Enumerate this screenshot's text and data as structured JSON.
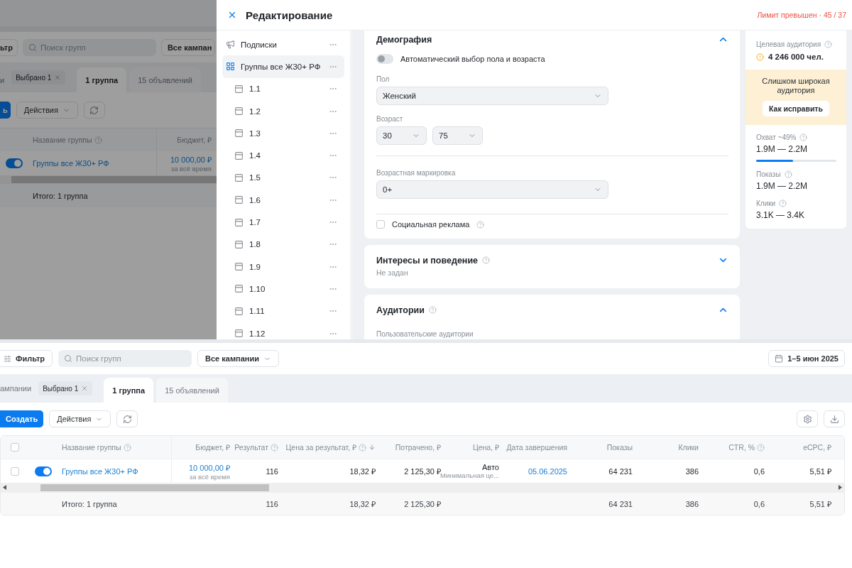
{
  "background_view": {
    "filter_button": "ьтр",
    "search": {
      "placeholder": "Поиск групп"
    },
    "campaign_select": "Все кампан",
    "tabs": [
      {
        "label": "и",
        "chip": "Выбрано 1",
        "selected": false
      },
      {
        "label": "1 группа",
        "selected": true
      },
      {
        "label": "15 объявлений",
        "selected": false
      }
    ],
    "create_button": "ь",
    "actions_button": "Действия",
    "columns": [
      {
        "label": "Название группы",
        "help": true
      },
      {
        "label": "Бюджет, ₽",
        "help": false
      }
    ],
    "rows": [
      {
        "enabled": true,
        "cells": [
          {
            "kind": "link",
            "text": "Группы все Ж30+ РФ"
          },
          {
            "kind": "link",
            "text": "10 000,00 ₽",
            "note": "за всё время"
          }
        ]
      }
    ],
    "total": "Итого: 1 группа"
  },
  "editor": {
    "title": "Редактирование",
    "limit": "Лимит превышен · 45 / 37",
    "tree": [
      {
        "kind": "campaign",
        "label": "Подписки",
        "selected": false
      },
      {
        "kind": "group",
        "label": "Группы все Ж30+ РФ",
        "selected": true,
        "children": [
          {
            "kind": "ad",
            "label": "1.1",
            "selected": false
          },
          {
            "kind": "ad",
            "label": "1.2",
            "selected": false
          },
          {
            "kind": "ad",
            "label": "1.3",
            "selected": false
          },
          {
            "kind": "ad",
            "label": "1.4",
            "selected": false
          },
          {
            "kind": "ad",
            "label": "1.5",
            "selected": false
          },
          {
            "kind": "ad",
            "label": "1.6",
            "selected": false
          },
          {
            "kind": "ad",
            "label": "1.7",
            "selected": false
          },
          {
            "kind": "ad",
            "label": "1.8",
            "selected": false
          },
          {
            "kind": "ad",
            "label": "1.9",
            "selected": false
          },
          {
            "kind": "ad",
            "label": "1.10",
            "selected": false
          },
          {
            "kind": "ad",
            "label": "1.11",
            "selected": false
          },
          {
            "kind": "ad",
            "label": "1.12",
            "selected": false
          }
        ]
      }
    ],
    "sections": [
      {
        "kind": "demography",
        "title": "Демография",
        "help": false,
        "expanded": true,
        "auto_toggle": {
          "label": "Автоматический выбор пола и возраста",
          "on": false
        },
        "gender": {
          "label": "Пол",
          "value": "Женский"
        },
        "age": {
          "label": "Возраст",
          "from": "30",
          "to": "75"
        },
        "age_marking": {
          "label": "Возрастная маркировка",
          "value": "0+"
        },
        "social_ad": {
          "label": "Социальная реклама",
          "checked": false,
          "help": true
        }
      },
      {
        "kind": "summary",
        "title": "Интересы и поведение",
        "help": true,
        "expanded": false,
        "summary": "Не задан"
      },
      {
        "kind": "list",
        "title": "Аудитории",
        "help": true,
        "expanded": true,
        "subtitle": "Пользовательские аудитории"
      }
    ],
    "forecast": {
      "title": "Целевая аудитория",
      "audience": "4 246 000 чел.",
      "warning": "Слишком широкая аудитория",
      "fix_button": "Как исправить",
      "metrics": [
        {
          "label": "Охват ~49%",
          "value": "1.9M — 2.2M",
          "level": 0.46
        },
        {
          "label": "Показы",
          "value": "1.9M — 2.2M"
        },
        {
          "label": "Клики",
          "value": "3.1K — 3.4K"
        }
      ]
    }
  },
  "table_view": {
    "filter_button": "Фильтр",
    "search": {
      "placeholder": "Поиск групп"
    },
    "campaign_select": "Все кампании",
    "date_button": "1–5 июн 2025",
    "tabs": [
      {
        "label": "ампании",
        "chip": "Выбрано 1",
        "selected": false
      },
      {
        "label": "1 группа",
        "selected": true
      },
      {
        "label": "15 объявлений",
        "selected": false
      }
    ],
    "create_button": "Создать",
    "actions_button": "Действия",
    "select_all": {
      "checked": false
    },
    "columns": [
      {
        "label": "Название группы",
        "help": true,
        "sorted": false
      },
      {
        "label": "Бюджет, ₽",
        "help": false,
        "sorted": false
      },
      {
        "label": "Результат",
        "help": true,
        "sorted": false
      },
      {
        "label": "Цена за результат, ₽",
        "help": true,
        "sorted": true
      },
      {
        "label": "Потрачено, ₽",
        "help": false,
        "sorted": false
      },
      {
        "label": "Цена, ₽",
        "help": false,
        "sorted": false
      },
      {
        "label": "Дата завершения",
        "help": false,
        "sorted": false
      },
      {
        "label": "Показы",
        "help": false,
        "sorted": false
      },
      {
        "label": "Клики",
        "help": false,
        "sorted": false
      },
      {
        "label": "CTR, %",
        "help": true,
        "sorted": false
      },
      {
        "label": "eCPC, ₽",
        "help": false,
        "sorted": false
      }
    ],
    "rows": [
      {
        "checked": false,
        "enabled": true,
        "cells": [
          {
            "kind": "link",
            "text": "Группы все Ж30+ РФ"
          },
          {
            "kind": "link",
            "text": "10 000,00 ₽",
            "note": "за всё время"
          },
          {
            "kind": "plain",
            "text": "116"
          },
          {
            "kind": "plain",
            "text": "18,32 ₽"
          },
          {
            "kind": "plain",
            "text": "2 125,30 ₽"
          },
          {
            "kind": "plain",
            "text": "Авто",
            "note": "Минимальная це..."
          },
          {
            "kind": "link",
            "text": "05.06.2025"
          },
          {
            "kind": "plain",
            "text": "64 231"
          },
          {
            "kind": "plain",
            "text": "386"
          },
          {
            "kind": "plain",
            "text": "0,6"
          },
          {
            "kind": "plain",
            "text": "5,51 ₽"
          }
        ]
      }
    ],
    "totals": {
      "cells": [
        "Итого: 1 группа",
        null,
        "116",
        "18,32 ₽",
        "2 125,30 ₽",
        null,
        null,
        "64 231",
        "386",
        "0,6",
        "5,51 ₽"
      ]
    }
  }
}
